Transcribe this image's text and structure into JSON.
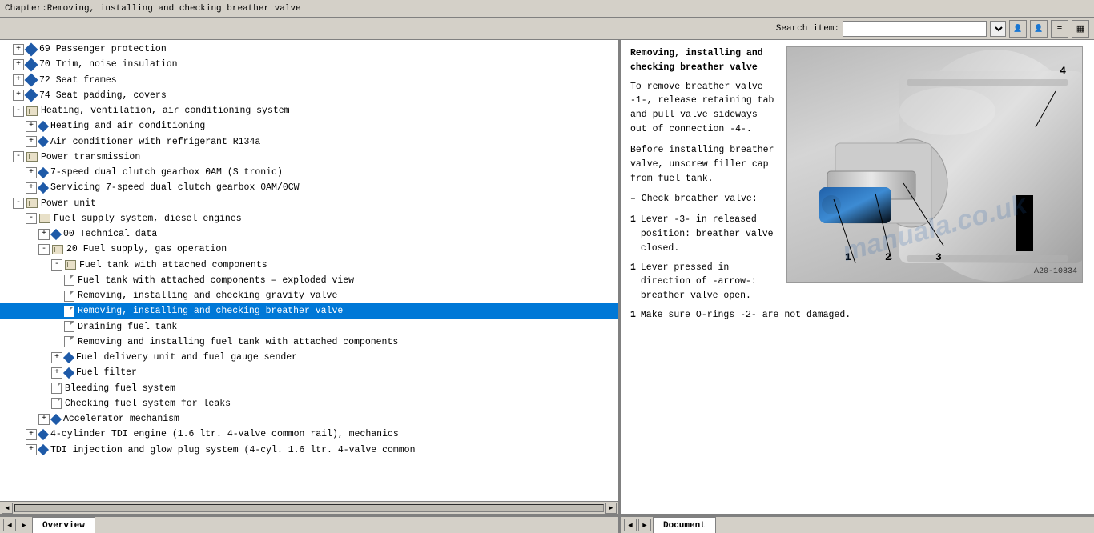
{
  "title_bar": {
    "text": "Chapter:Removing, installing and checking breather valve"
  },
  "toolbar": {
    "search_label": "Search item:",
    "search_placeholder": "",
    "btn1": "👤",
    "btn2": "👤",
    "btn3": "≡",
    "btn4": "▦"
  },
  "tree": {
    "items": [
      {
        "id": "t1",
        "label": "69  Passenger protection",
        "indent": "indent-1",
        "type": "diamond",
        "expand": "+"
      },
      {
        "id": "t2",
        "label": "70  Trim, noise insulation",
        "indent": "indent-1",
        "type": "diamond",
        "expand": "+"
      },
      {
        "id": "t3",
        "label": "72  Seat frames",
        "indent": "indent-1",
        "type": "diamond",
        "expand": "+"
      },
      {
        "id": "t4",
        "label": "74  Seat padding, covers",
        "indent": "indent-1",
        "type": "diamond",
        "expand": "+"
      },
      {
        "id": "t5",
        "label": "Heating, ventilation, air conditioning system",
        "indent": "indent-1",
        "type": "book-expand"
      },
      {
        "id": "t6",
        "label": "Heating and air conditioning",
        "indent": "indent-2",
        "type": "diamond",
        "expand": "+"
      },
      {
        "id": "t7",
        "label": "Air conditioner with refrigerant R134a",
        "indent": "indent-2",
        "type": "diamond",
        "expand": "+"
      },
      {
        "id": "t8",
        "label": "Power transmission",
        "indent": "indent-1",
        "type": "book-expand"
      },
      {
        "id": "t9",
        "label": "7-speed dual clutch gearbox 0AM (S tronic)",
        "indent": "indent-2",
        "type": "diamond",
        "expand": "+"
      },
      {
        "id": "t10",
        "label": "Servicing 7-speed dual clutch gearbox 0AM/0CW",
        "indent": "indent-2",
        "type": "diamond",
        "expand": "+"
      },
      {
        "id": "t11",
        "label": "Power unit",
        "indent": "indent-1",
        "type": "book-expand"
      },
      {
        "id": "t12",
        "label": "Fuel supply system, diesel engines",
        "indent": "indent-2",
        "type": "book-expand"
      },
      {
        "id": "t13",
        "label": "00  Technical data",
        "indent": "indent-3",
        "type": "diamond",
        "expand": "+"
      },
      {
        "id": "t14",
        "label": "20  Fuel supply, gas operation",
        "indent": "indent-3",
        "type": "book-expand"
      },
      {
        "id": "t15",
        "label": "Fuel tank with attached components",
        "indent": "indent-4",
        "type": "book-expand"
      },
      {
        "id": "t16",
        "label": "Fuel tank with attached components – exploded view",
        "indent": "indent-5",
        "type": "doc"
      },
      {
        "id": "t17",
        "label": "Removing, installing and checking gravity valve",
        "indent": "indent-5",
        "type": "doc"
      },
      {
        "id": "t18",
        "label": "Removing, installing and checking breather valve",
        "indent": "indent-5",
        "type": "doc",
        "selected": true
      },
      {
        "id": "t19",
        "label": "Draining fuel tank",
        "indent": "indent-5",
        "type": "doc"
      },
      {
        "id": "t20",
        "label": "Removing and installing fuel tank with attached components",
        "indent": "indent-5",
        "type": "doc"
      },
      {
        "id": "t21",
        "label": "Fuel delivery unit and fuel gauge sender",
        "indent": "indent-4",
        "type": "diamond",
        "expand": "+"
      },
      {
        "id": "t22",
        "label": "Fuel filter",
        "indent": "indent-4",
        "type": "diamond",
        "expand": "+"
      },
      {
        "id": "t23",
        "label": "Bleeding fuel system",
        "indent": "indent-4",
        "type": "doc"
      },
      {
        "id": "t24",
        "label": "Checking fuel system for leaks",
        "indent": "indent-4",
        "type": "doc"
      },
      {
        "id": "t25",
        "label": "Accelerator mechanism",
        "indent": "indent-3",
        "type": "diamond",
        "expand": "+"
      },
      {
        "id": "t26",
        "label": "4-cylinder TDI engine (1.6 ltr. 4-valve common rail), mechanics",
        "indent": "indent-2",
        "type": "diamond",
        "expand": "+"
      },
      {
        "id": "t27",
        "label": "TDI injection and glow plug system (4-cyl. 1.6 ltr. 4-valve common",
        "indent": "indent-2",
        "type": "diamond",
        "expand": "+"
      }
    ]
  },
  "document": {
    "title": "Removing, installing and checking breather valve",
    "section1": "To remove breather valve -1-, release retaining tab and pull valve sideways out of connection -4-.",
    "section2": "Before installing breather valve, unscrew filler cap from fuel tank.",
    "section3": "– Check breather valve:",
    "list_items": [
      {
        "num": "1",
        "text": "Lever -3- in released position: breather valve closed."
      },
      {
        "num": "1",
        "text": "Lever pressed in direction of -arrow-: breather valve open."
      },
      {
        "num": "1",
        "text": "Make sure O-rings -2- are not damaged."
      }
    ],
    "image_label": "A20-10834",
    "watermark": "manuala.co.uk",
    "part_numbers": [
      "1",
      "2",
      "3",
      "4"
    ]
  },
  "bottom": {
    "left_tab": "Overview",
    "right_tab": "Document",
    "nav_left": "◄",
    "nav_right": "►"
  }
}
